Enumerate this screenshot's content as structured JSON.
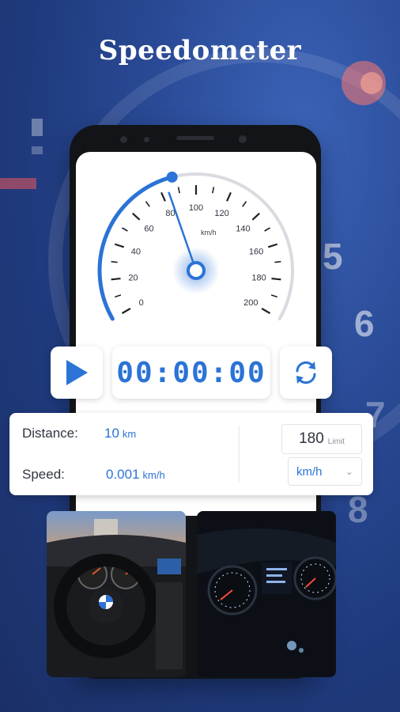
{
  "header": {
    "title": "Speedometer"
  },
  "gauge": {
    "ticks": [
      "0",
      "20",
      "40",
      "60",
      "80",
      "100",
      "120",
      "140",
      "160",
      "180",
      "200"
    ],
    "unit": "km/h",
    "current_speed": 0.001,
    "max": 200,
    "colors": {
      "arc": "#2b73d6",
      "track": "#d9dbe0",
      "needle": "#2b73d6"
    }
  },
  "controls": {
    "play_icon": "play-icon",
    "timer": "00:00:00",
    "reset_icon": "refresh-icon"
  },
  "stats": {
    "distance_label": "Distance:",
    "distance_value": "10",
    "distance_unit": "km",
    "speed_label": "Speed:",
    "speed_value": "0.001",
    "speed_unit": "km/h",
    "limit_value": "180",
    "limit_label": "Limit",
    "unit_selected": "km/h"
  },
  "photos": [
    {
      "name": "car-interior-steering-wheel"
    },
    {
      "name": "dashboard-gauges-night"
    }
  ]
}
